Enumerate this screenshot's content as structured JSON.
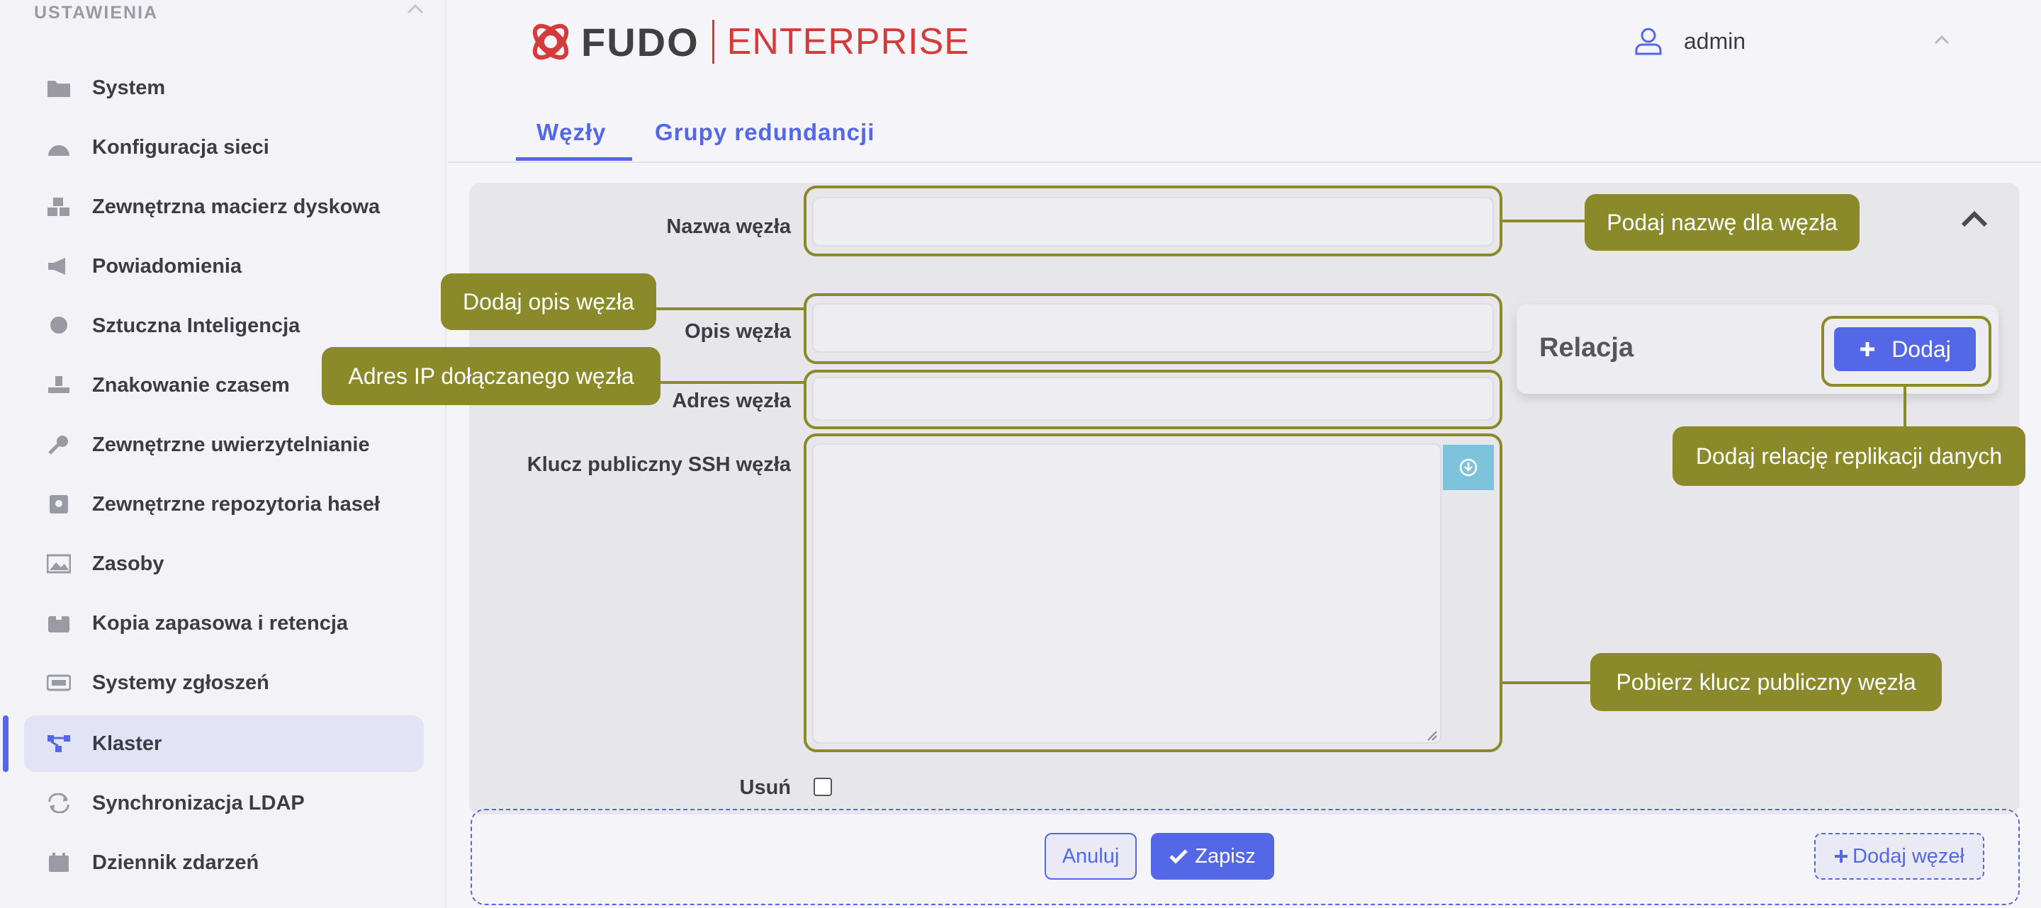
{
  "sidebar": {
    "header": "USTAWIENIA",
    "items": [
      {
        "label": "System",
        "icon": "folder-icon"
      },
      {
        "label": "Konfiguracja sieci",
        "icon": "network-icon"
      },
      {
        "label": "Zewnętrzna macierz dyskowa",
        "icon": "storage-icon"
      },
      {
        "label": "Powiadomienia",
        "icon": "megaphone-icon"
      },
      {
        "label": "Sztuczna Inteligencja",
        "icon": "brain-icon"
      },
      {
        "label": "Znakowanie czasem",
        "icon": "stamp-icon"
      },
      {
        "label": "Zewnętrzne uwierzytelnianie",
        "icon": "key-icon"
      },
      {
        "label": "Zewnętrzne repozytoria haseł",
        "icon": "vault-icon"
      },
      {
        "label": "Zasoby",
        "icon": "image-icon"
      },
      {
        "label": "Kopia zapasowa i retencja",
        "icon": "archive-icon"
      },
      {
        "label": "Systemy zgłoszeń",
        "icon": "ticket-icon"
      },
      {
        "label": "Klaster",
        "icon": "cluster-icon",
        "active": true
      },
      {
        "label": "Synchronizacja LDAP",
        "icon": "sync-icon"
      },
      {
        "label": "Dziennik zdarzeń",
        "icon": "calendar-icon"
      }
    ]
  },
  "header": {
    "logo_main": "FUDO",
    "logo_sub": "ENTERPRISE",
    "user": "admin"
  },
  "tabs": [
    {
      "label": "Węzły",
      "active": true
    },
    {
      "label": "Grupy redundancji",
      "active": false
    }
  ],
  "form": {
    "node_name_label": "Nazwa węzła",
    "node_name_value": "",
    "node_desc_label": "Opis węzła",
    "node_desc_value": "",
    "node_address_label": "Adres węzła",
    "node_address_value": "",
    "ssh_key_label": "Klucz publiczny SSH węzła",
    "ssh_key_value": "",
    "delete_label": "Usuń",
    "delete_checked": false
  },
  "relation": {
    "title": "Relacja",
    "add_label": "Dodaj"
  },
  "callouts": {
    "name": "Podaj nazwę dla węzła",
    "desc": "Dodaj opis węzła",
    "address": "Adres IP dołączanego węzła",
    "relation": "Dodaj relację replikacji danych",
    "key": "Pobierz klucz publiczny węzła"
  },
  "footer": {
    "cancel": "Anuluj",
    "save": "Zapisz",
    "add_node": "Dodaj węzeł"
  },
  "colors": {
    "accent": "#5468e7",
    "callout": "#8a8a2a",
    "brand_red": "#d43b3b"
  }
}
